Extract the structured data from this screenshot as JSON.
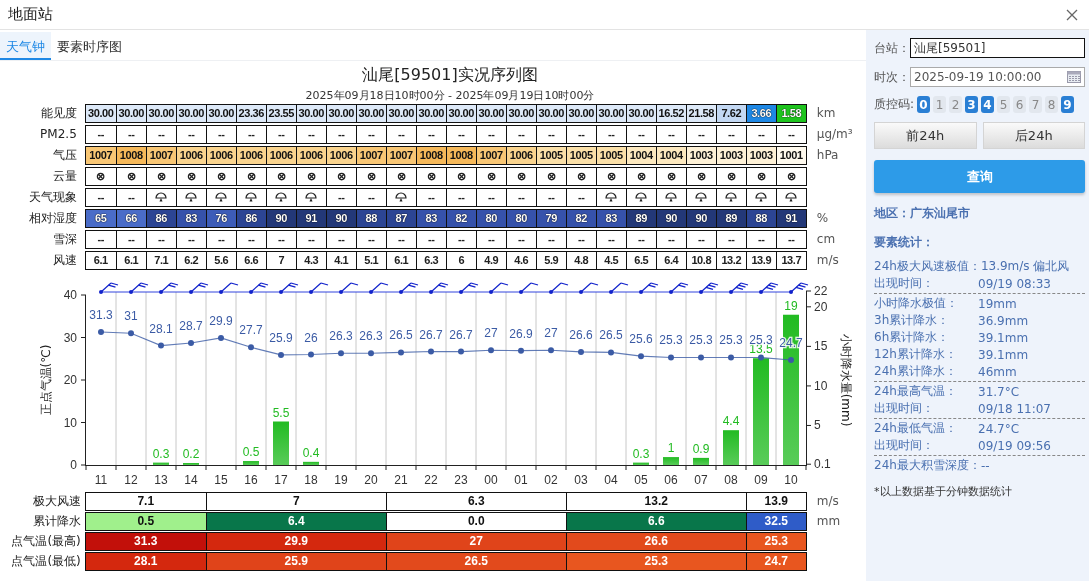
{
  "window": {
    "title": "地面站"
  },
  "tabs": [
    {
      "label": "天气钟",
      "selected": true
    },
    {
      "label": "要素时序图",
      "selected": false
    }
  ],
  "chart_title": "汕尾[59501]实况序列图",
  "chart_subtitle": "2025年09月18日10时00分 - 2025年09月19日10时00分",
  "element_table": [
    {
      "label": "能见度",
      "unit": "km",
      "cells": [
        {
          "text": "30.00",
          "color": "#dde9f8"
        },
        {
          "text": "30.00",
          "color": "#dde9f8"
        },
        {
          "text": "30.00",
          "color": "#dde9f8"
        },
        {
          "text": "30.00",
          "color": "#dde9f8"
        },
        {
          "text": "30.00",
          "color": "#dde9f8"
        },
        {
          "text": "23.36",
          "color": "#dde9f8"
        },
        {
          "text": "23.55",
          "color": "#dde9f8"
        },
        {
          "text": "30.00",
          "color": "#dde9f8"
        },
        {
          "text": "30.00",
          "color": "#dde9f8"
        },
        {
          "text": "30.00",
          "color": "#dde9f8"
        },
        {
          "text": "30.00",
          "color": "#dde9f8"
        },
        {
          "text": "30.00",
          "color": "#dde9f8"
        },
        {
          "text": "30.00",
          "color": "#dde9f8"
        },
        {
          "text": "30.00",
          "color": "#dde9f8"
        },
        {
          "text": "30.00",
          "color": "#dde9f8"
        },
        {
          "text": "30.00",
          "color": "#dde9f8"
        },
        {
          "text": "30.00",
          "color": "#dde9f8"
        },
        {
          "text": "30.00",
          "color": "#dde9f8"
        },
        {
          "text": "30.00",
          "color": "#dde9f8"
        },
        {
          "text": "16.52",
          "color": "#dde9f8"
        },
        {
          "text": "21.58",
          "color": "#dde9f8"
        },
        {
          "text": "7.62",
          "color": "#c3d8f3"
        },
        {
          "text": "3.66",
          "color": "#1e88e5"
        },
        {
          "text": "1.58",
          "color": "#1ec41e"
        }
      ]
    },
    {
      "label": "PM2.5",
      "unit": "μg/m³",
      "cells": [
        "--",
        "--",
        "--",
        "--",
        "--",
        "--",
        "--",
        "--",
        "--",
        "--",
        "--",
        "--",
        "--",
        "--",
        "--",
        "--",
        "--",
        "--",
        "--",
        "--",
        "--",
        "--",
        "--",
        "--"
      ]
    },
    {
      "label": "气压",
      "unit": "hPa",
      "cells": [
        {
          "text": "1007",
          "color": "#f9c775"
        },
        {
          "text": "1008",
          "color": "#f6b95a"
        },
        {
          "text": "1007",
          "color": "#f9c775"
        },
        {
          "text": "1006",
          "color": "#fad48e"
        },
        {
          "text": "1006",
          "color": "#fad48e"
        },
        {
          "text": "1006",
          "color": "#fad48e"
        },
        {
          "text": "1006",
          "color": "#fad48e"
        },
        {
          "text": "1006",
          "color": "#fad48e"
        },
        {
          "text": "1006",
          "color": "#fad48e"
        },
        {
          "text": "1007",
          "color": "#f9c775"
        },
        {
          "text": "1007",
          "color": "#f9c775"
        },
        {
          "text": "1008",
          "color": "#f6b95a"
        },
        {
          "text": "1008",
          "color": "#f6b95a"
        },
        {
          "text": "1007",
          "color": "#f9c775"
        },
        {
          "text": "1006",
          "color": "#fad48e"
        },
        {
          "text": "1005",
          "color": "#fbe0a8"
        },
        {
          "text": "1005",
          "color": "#fbe0a8"
        },
        {
          "text": "1005",
          "color": "#fbe0a8"
        },
        {
          "text": "1004",
          "color": "#fde9bf"
        },
        {
          "text": "1004",
          "color": "#fde9bf"
        },
        {
          "text": "1003",
          "color": "#fef1d6"
        },
        {
          "text": "1003",
          "color": "#fef1d6"
        },
        {
          "text": "1003",
          "color": "#fef1d6"
        },
        {
          "text": "1001",
          "color": "#fffaee"
        }
      ]
    },
    {
      "label": "云量",
      "cells": [
        "⊗",
        "⊗",
        "⊗",
        "⊗",
        "⊗",
        "⊗",
        "⊗",
        "⊗",
        "⊗",
        "⊗",
        "⊗",
        "⊗",
        "⊗",
        "⊗",
        "⊗",
        "⊗",
        "⊗",
        "⊗",
        "⊗",
        "⊗",
        "⊗",
        "⊗",
        "⊗",
        "⊗"
      ]
    },
    {
      "label": "天气现象",
      "cells": [
        "--",
        "--",
        {
          "kind": "shower"
        },
        {
          "kind": "shower"
        },
        {
          "kind": "shower"
        },
        {
          "kind": "shower"
        },
        {
          "kind": "shower"
        },
        {
          "kind": "shower"
        },
        "--",
        "--",
        {
          "kind": "shower"
        },
        "--",
        "--",
        "--",
        "--",
        "--",
        "--",
        {
          "kind": "shower"
        },
        {
          "kind": "shower"
        },
        {
          "kind": "shower"
        },
        {
          "kind": "shower"
        },
        {
          "kind": "shower"
        },
        {
          "kind": "shower"
        },
        {
          "kind": "shower"
        }
      ]
    },
    {
      "label": "相对湿度",
      "unit": "%",
      "cells": [
        {
          "text": "65",
          "color": "#4a6cc8"
        },
        {
          "text": "66",
          "color": "#4a6cc8"
        },
        {
          "text": "86",
          "color": "#2c4594"
        },
        {
          "text": "83",
          "color": "#3652ab"
        },
        {
          "text": "76",
          "color": "#3d5cb8"
        },
        {
          "text": "86",
          "color": "#2c4594"
        },
        {
          "text": "90",
          "color": "#233878"
        },
        {
          "text": "91",
          "color": "#233878"
        },
        {
          "text": "90",
          "color": "#233878"
        },
        {
          "text": "88",
          "color": "#2c4594"
        },
        {
          "text": "87",
          "color": "#2c4594"
        },
        {
          "text": "83",
          "color": "#3652ab"
        },
        {
          "text": "82",
          "color": "#3652ab"
        },
        {
          "text": "80",
          "color": "#3652ab"
        },
        {
          "text": "80",
          "color": "#3652ab"
        },
        {
          "text": "79",
          "color": "#3652ab"
        },
        {
          "text": "82",
          "color": "#3652ab"
        },
        {
          "text": "83",
          "color": "#3652ab"
        },
        {
          "text": "89",
          "color": "#233878"
        },
        {
          "text": "90",
          "color": "#233878"
        },
        {
          "text": "90",
          "color": "#233878"
        },
        {
          "text": "89",
          "color": "#233878"
        },
        {
          "text": "88",
          "color": "#2c4594"
        },
        {
          "text": "91",
          "color": "#233878"
        }
      ]
    },
    {
      "label": "雪深",
      "unit": "cm",
      "cells": [
        "--",
        "--",
        "--",
        "--",
        "--",
        "--",
        "--",
        "--",
        "--",
        "--",
        "--",
        "--",
        "--",
        "--",
        "--",
        "--",
        "--",
        "--",
        "--",
        "--",
        "--",
        "--",
        "--",
        "--"
      ]
    },
    {
      "label": "风速",
      "unit": "m/s",
      "cells": [
        "6.1",
        "6.1",
        "7.1",
        "6.2",
        "5.6",
        "6.6",
        "7",
        "4.3",
        "4.1",
        "5.1",
        "6.1",
        "6.3",
        "6",
        "4.9",
        "4.6",
        "5.9",
        "4.8",
        "4.5",
        "6.5",
        "6.4",
        "10.8",
        "13.2",
        "13.9",
        "13.7"
      ]
    }
  ],
  "temperature_chart": {
    "chart_data": {
      "type": "line",
      "categories": [
        "11",
        "12",
        "13",
        "14",
        "15",
        "16",
        "17",
        "18",
        "19",
        "20",
        "21",
        "22",
        "23",
        "00",
        "01",
        "02",
        "03",
        "04",
        "05",
        "06",
        "07",
        "08",
        "09",
        "10"
      ],
      "ylabel": "正点气温(℃)",
      "ylim": [
        0,
        40
      ],
      "yticks": [
        0,
        10,
        20,
        30,
        40
      ],
      "data_labels": true,
      "series": [
        {
          "color": "#3b5ba5",
          "marker": "circle",
          "values": [
            31.3,
            31,
            28.1,
            28.7,
            29.9,
            27.7,
            25.9,
            26,
            26.3,
            26.3,
            26.5,
            26.7,
            26.7,
            27,
            26.9,
            27,
            26.6,
            26.5,
            25.6,
            25.3,
            25.3,
            25.3,
            25.3,
            24.7
          ]
        }
      ]
    }
  },
  "precipitation_chart": {
    "chart_data": {
      "type": "bar",
      "ylabel": "小时降水量(mm)",
      "ylim": [
        0,
        22
      ],
      "yticks": [
        0.1,
        5,
        10,
        15,
        20,
        22
      ],
      "data_labels": true,
      "series": [
        {
          "color": "#22bb22",
          "values": [
            null,
            null,
            0.3,
            0.2,
            null,
            0.5,
            5.5,
            0.4,
            null,
            null,
            null,
            null,
            null,
            null,
            null,
            null,
            null,
            null,
            0.3,
            1,
            0.9,
            4.4,
            13.5,
            19
          ]
        }
      ]
    }
  },
  "summary_table": [
    {
      "label": "极大风速",
      "unit": "m/s",
      "cells": [
        {
          "text": "7.1",
          "color": "#ffffff"
        },
        {
          "text": "7",
          "color": "#ffffff"
        },
        {
          "text": "6.3",
          "color": "#ffffff"
        },
        {
          "text": "13.2",
          "color": "#ffffff"
        },
        {
          "text": "13.9",
          "color": "#ffffff"
        }
      ]
    },
    {
      "label": "累计降水",
      "unit": "mm",
      "cells": [
        {
          "text": "0.5",
          "color": "#a0f08c"
        },
        {
          "text": "6.4",
          "color": "#08764a"
        },
        {
          "text": "0.0",
          "color": "#ffffff"
        },
        {
          "text": "6.6",
          "color": "#08764a"
        },
        {
          "text": "32.5",
          "color": "#2f5cc8"
        }
      ]
    },
    {
      "label": "点气温(最高)",
      "cells": [
        {
          "text": "31.3",
          "color": "#c2100a"
        },
        {
          "text": "29.9",
          "color": "#d4280e"
        },
        {
          "text": "27",
          "color": "#e0441a"
        },
        {
          "text": "26.6",
          "color": "#e24a1c"
        },
        {
          "text": "25.3",
          "color": "#e8561f"
        }
      ]
    },
    {
      "label": "点气温(最低)",
      "cells": [
        {
          "text": "28.1",
          "color": "#d4280e"
        },
        {
          "text": "25.9",
          "color": "#e0441a"
        },
        {
          "text": "26.5",
          "color": "#e24a1c"
        },
        {
          "text": "25.3",
          "color": "#e8561f"
        },
        {
          "text": "24.7",
          "color": "#e8561f"
        }
      ]
    }
  ],
  "side_panel": {
    "station": {
      "label": "台站：",
      "value": "汕尾[59501]"
    },
    "time": {
      "label": "时次：",
      "value": "2025-09-19 10:00:00"
    },
    "qc": {
      "label": "质控码:",
      "codes": [
        {
          "label": "0",
          "selected": true
        },
        {
          "label": "1",
          "selected": false
        },
        {
          "label": "2",
          "selected": false
        },
        {
          "label": "3",
          "selected": true
        },
        {
          "label": "4",
          "selected": true
        },
        {
          "label": "5",
          "selected": false
        },
        {
          "label": "6",
          "selected": false
        },
        {
          "label": "7",
          "selected": false
        },
        {
          "label": "8",
          "selected": false
        },
        {
          "label": "9",
          "selected": true
        }
      ]
    },
    "nav_buttons": [
      "前24h",
      "后24h"
    ],
    "query_button": "查询",
    "region": "地区：广东汕尾市",
    "stats_title": "要素统计：",
    "stats_groups": [
      [
        {
          "label": "24h极大风速极值：",
          "value": "13.9m/s 偏北风"
        },
        {
          "label": "出现时间：",
          "value": "09/19 08:33"
        }
      ],
      [
        {
          "label": "小时降水极值：",
          "value": "19mm"
        },
        {
          "label": "3h累计降水：",
          "value": "36.9mm"
        },
        {
          "label": "6h累计降水：",
          "value": "39.1mm"
        },
        {
          "label": "12h累计降水：",
          "value": "39.1mm"
        },
        {
          "label": "24h累计降水：",
          "value": "46mm"
        }
      ],
      [
        {
          "label": "24h最高气温：",
          "value": "31.7°C"
        },
        {
          "label": "出现时间：",
          "value": "09/18 11:07"
        }
      ],
      [
        {
          "label": "24h最低气温：",
          "value": "24.7°C"
        },
        {
          "label": "出现时间：",
          "value": "09/19 09:56"
        }
      ],
      [
        {
          "label": "24h最大积雪深度：",
          "value": "--"
        }
      ]
    ],
    "footnote": "*以上数据基于分钟数据统计"
  }
}
